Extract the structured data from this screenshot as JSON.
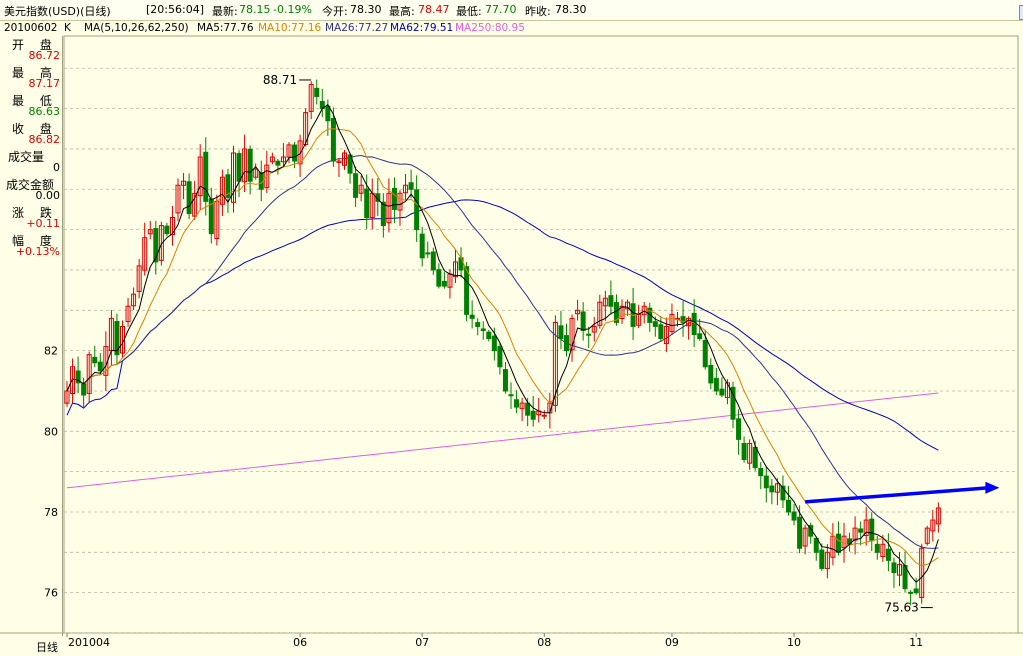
{
  "header": {
    "title": "美元指数(USD)(日线)",
    "time": "[20:56:04]",
    "latest_label": "最新:",
    "latest_value": "78.15",
    "change_value": "-0.19%",
    "open_label": "今开:",
    "open_value": "78.30",
    "high_label": "最高:",
    "high_value": "78.47",
    "low_label": "最低:",
    "low_value": "77.70",
    "prev_label": "昨收:",
    "prev_value": "78.30"
  },
  "ma_legend": {
    "date": "20100602",
    "k": "K",
    "ma_prefix": "MA(5,10,26,62,250)",
    "ma5": "MA5:77.76",
    "ma10": "MA10:77.16",
    "ma26": "MA26:77.27",
    "ma62": "MA62:79.51",
    "ma250": "MA250:80.95"
  },
  "info_panel": {
    "open_label": "开 盘",
    "open_value": "86.72",
    "high_label": "最 高",
    "high_value": "87.17",
    "low_label": "最 低",
    "low_value": "86.63",
    "close_label": "收 盘",
    "close_value": "86.82",
    "volume_label": "成交量",
    "volume_value": "0",
    "amount_label": "成交金额",
    "amount_value": "0.00",
    "change_label": "涨 跌",
    "change_value": "+0.11",
    "range_label": "幅 度",
    "range_value": "+0.13%"
  },
  "bottom": {
    "period_label": "日线"
  },
  "colors": {
    "background": "#ffffe8",
    "up_candle": "#e00000",
    "down_candle": "#008000",
    "ma5": "#000000",
    "ma10": "#e08000",
    "ma26": "#303090",
    "ma62": "#0000c0",
    "ma250": "#e060e0",
    "trend_arrow": "#0000ff"
  },
  "chart_data": {
    "type": "candlestick",
    "y_ticks": [
      76,
      78,
      80,
      82
    ],
    "ylim": [
      75.0,
      89.8
    ],
    "x_labels": [
      {
        "label": "201004",
        "index": 0
      },
      {
        "label": "06",
        "index": 42
      },
      {
        "label": "07",
        "index": 64
      },
      {
        "label": "08",
        "index": 86
      },
      {
        "label": "09",
        "index": 109
      },
      {
        "label": "10",
        "index": 131
      },
      {
        "label": "11",
        "index": 153
      }
    ],
    "annotations": [
      {
        "text": "88.71",
        "index": 44,
        "value": 88.71
      },
      {
        "text": "75.63",
        "index": 156,
        "value": 75.63
      }
    ],
    "trend_line": {
      "from_index": 133,
      "from_value": 78.25,
      "to_index": 168,
      "to_value": 78.6
    },
    "closes": [
      81.0,
      81.6,
      81.2,
      80.9,
      81.9,
      81.7,
      81.5,
      82.1,
      82.8,
      81.9,
      82.6,
      83.1,
      83.4,
      84.1,
      84.8,
      85.0,
      84.2,
      85.1,
      84.9,
      85.3,
      86.1,
      86.2,
      85.4,
      85.9,
      86.8,
      85.7,
      84.9,
      85.7,
      86.3,
      85.8,
      86.9,
      86.2,
      87.0,
      86.2,
      86.5,
      86.0,
      86.6,
      86.8,
      86.6,
      86.8,
      87.1,
      86.7,
      87.2,
      87.9,
      88.6,
      88.3,
      88.0,
      87.7,
      86.7,
      86.7,
      86.9,
      86.4,
      85.8,
      86.1,
      85.3,
      85.9,
      85.7,
      85.1,
      85.9,
      85.5,
      85.9,
      86.1,
      86.0,
      85.0,
      84.3,
      84.4,
      84.0,
      83.6,
      83.6,
      83.9,
      84.2,
      84.0,
      82.9,
      82.8,
      82.6,
      82.5,
      82.3,
      82.0,
      81.6,
      81.0,
      80.9,
      80.6,
      80.7,
      80.4,
      80.3,
      80.5,
      80.4,
      80.7,
      82.7,
      82.3,
      82.0,
      82.8,
      83.0,
      82.5,
      82.4,
      82.6,
      83.2,
      83.3,
      83.1,
      82.7,
      83.1,
      83.2,
      82.6,
      82.9,
      83.1,
      82.7,
      82.6,
      82.3,
      82.6,
      82.9,
      82.8,
      82.7,
      82.8,
      82.4,
      82.3,
      81.6,
      81.2,
      81.0,
      80.9,
      81.2,
      80.3,
      79.8,
      79.3,
      79.7,
      79.1,
      78.9,
      78.6,
      78.5,
      78.7,
      78.3,
      78.0,
      77.8,
      77.1,
      77.6,
      77.4,
      77.0,
      76.6,
      77.0,
      77.4,
      77.0,
      77.4,
      77.2,
      77.6,
      77.5,
      77.8,
      77.3,
      77.0,
      77.2,
      76.8,
      76.5,
      76.7,
      76.1,
      76.0,
      76.0,
      77.1,
      77.6,
      77.8,
      78.1
    ],
    "dates_axis_note": ""
  }
}
